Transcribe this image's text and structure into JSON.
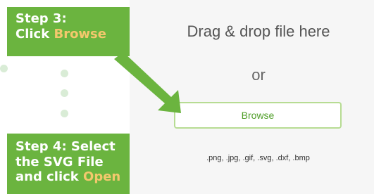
{
  "dropzone": {
    "drag_label": "Drag & drop file here",
    "or_label": "or",
    "browse_label": "Browse",
    "filetypes": ".png, .jpg, .gif, .svg, .dxf, .bmp"
  },
  "callouts": {
    "step3_line1": "Step 3:",
    "step3_line2_prefix": "Click ",
    "step3_highlight": "Browse",
    "step4_line1": "Step 4: Select",
    "step4_line2": "the SVG File",
    "step4_line3_prefix": "and click ",
    "step4_highlight": "Open"
  },
  "colors": {
    "callout_bg": "#6bb43f",
    "highlight_text": "#f4c86d",
    "browse_border": "#b7dc93",
    "browse_text": "#4f9e28",
    "dot": "#d9ecd6",
    "dropzone_bg": "#f6f6f6"
  },
  "icons": {
    "arrow": "step-arrow-icon",
    "dots": "step-connector-dot-icon"
  }
}
